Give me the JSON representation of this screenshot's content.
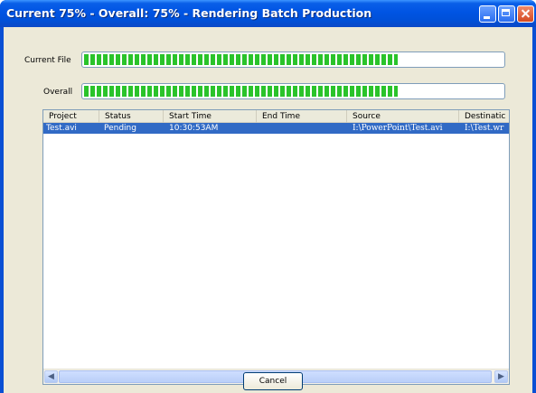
{
  "window": {
    "title": "Current 75% - Overall: 75% - Rendering Batch Production"
  },
  "progress": {
    "current_file": {
      "label": "Current File",
      "value": 0.75
    },
    "overall": {
      "label": "Overall",
      "value": 0.75
    }
  },
  "table": {
    "columns": [
      "Project",
      "Status",
      "Start Time",
      "End Time",
      "Source",
      "Destinatic"
    ],
    "rows": [
      {
        "project": "Test.avi",
        "status": "Pending",
        "start_time": "10:30:53AM",
        "end_time": "",
        "source": "I:\\PowerPoint\\Test.avi",
        "destination": "I:\\Test.wr",
        "selected": true
      }
    ]
  },
  "scrollbar": {
    "left_arrow": "◀",
    "right_arrow": "▶"
  },
  "buttons": {
    "cancel": "Cancel"
  }
}
